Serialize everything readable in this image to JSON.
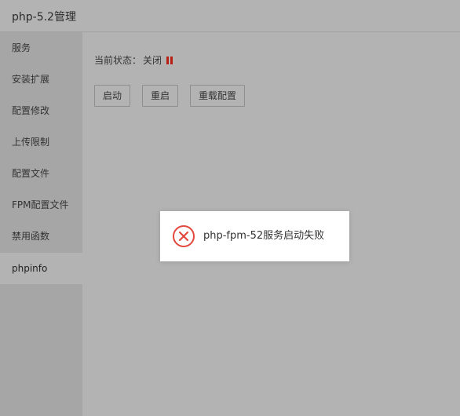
{
  "window": {
    "title": "php-5.2管理"
  },
  "sidebar": {
    "items": [
      {
        "label": "服务",
        "active": false
      },
      {
        "label": "安装扩展",
        "active": false
      },
      {
        "label": "配置修改",
        "active": false
      },
      {
        "label": "上传限制",
        "active": false
      },
      {
        "label": "配置文件",
        "active": false
      },
      {
        "label": "FPM配置文件",
        "active": false
      },
      {
        "label": "禁用函数",
        "active": false
      },
      {
        "label": "phpinfo",
        "active": true
      }
    ]
  },
  "service": {
    "status_label": "当前状态：",
    "status_value": "关闭",
    "status_icon": "pause-icon",
    "status_color": "#b81d14",
    "buttons": {
      "start": "启动",
      "restart": "重启",
      "reload": "重载配置"
    }
  },
  "toast": {
    "icon": "error-circle-icon",
    "icon_color": "#e2483c",
    "message": "php-fpm-52服务启动失败"
  }
}
